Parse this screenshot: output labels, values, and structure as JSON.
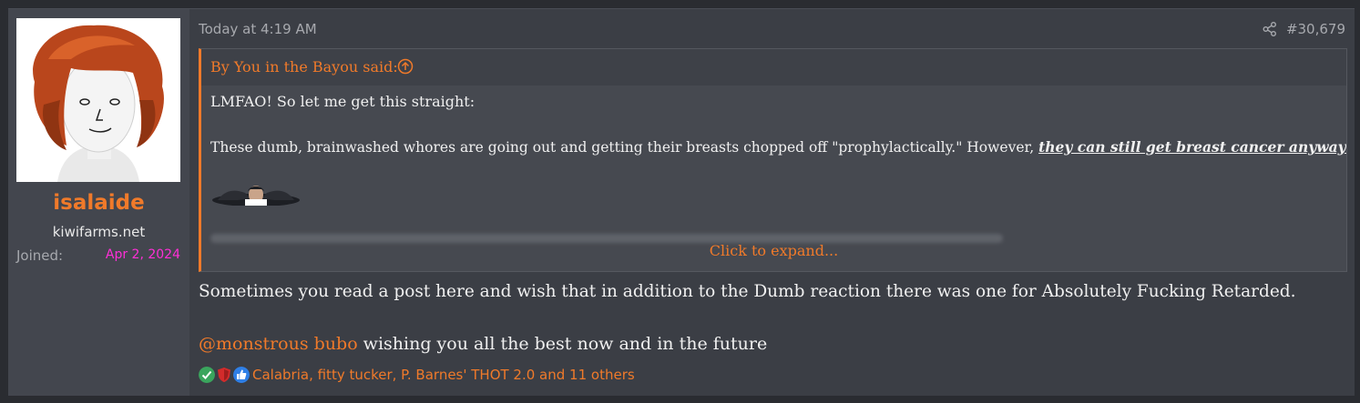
{
  "user": {
    "username": "isalaide",
    "title": "kiwifarms.net",
    "joined_label": "Joined:",
    "joined_value": "Apr 2, 2024"
  },
  "post": {
    "date": "Today at 4:19 AM",
    "number": "#30,679",
    "quote": {
      "attribution": "By You in the Bayou said:",
      "line1": "LMFAO! So let me get this straight:",
      "line2_plain": "These dumb, brainwashed whores are going out and getting their breasts chopped off \"prophylactically.\" However, ",
      "line2_emphasis": "they can still get breast cancer anyway?",
      "expand_label": "Click to expand..."
    },
    "message_line1": "Sometimes you read a post here and wish that in addition to the Dumb reaction there was one for Absolutely Fucking Retarded.",
    "mention": "@monstrous bubo",
    "message_line2": " wishing you all the best now and in the future",
    "reactions": {
      "names": "Calabria, fitty tucker, P. Barnes' THOT 2.0 and 11 others",
      "icons": [
        "check-reaction-icon",
        "shield-reaction-icon",
        "thumbs-up-reaction-icon"
      ]
    }
  },
  "colors": {
    "accent": "#f07a2a",
    "joined_date": "#ff2fd7",
    "background": "#3b3e45"
  }
}
